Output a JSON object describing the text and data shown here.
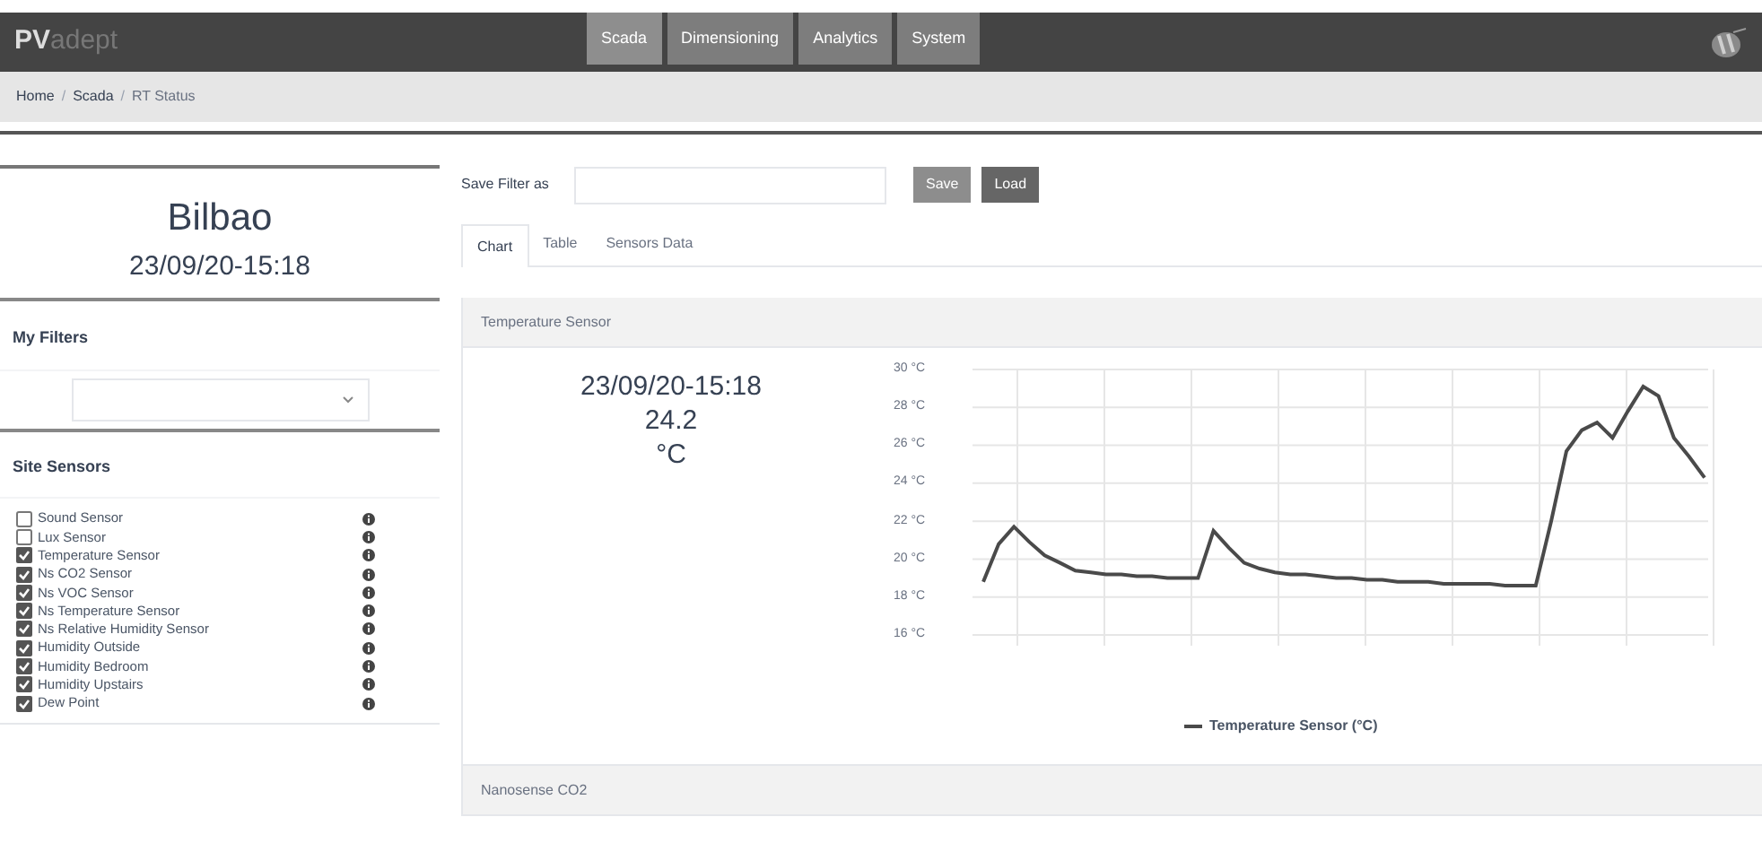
{
  "logo": {
    "bold": "PV",
    "rest": "adept"
  },
  "nav": [
    {
      "label": "Scada",
      "selected": true
    },
    {
      "label": "Dimensioning",
      "selected": false
    },
    {
      "label": "Analytics",
      "selected": false
    },
    {
      "label": "System",
      "selected": false
    }
  ],
  "breadcrumb": [
    "Home",
    "Scada",
    "RT Status"
  ],
  "breadcrumb_separator": "/",
  "site": {
    "name": "Bilbao",
    "timestamp": "23/09/20-15:18"
  },
  "my_filters": {
    "title": "My Filters"
  },
  "site_sensors": {
    "title": "Site Sensors",
    "items": [
      {
        "label": "Sound Sensor",
        "checked": false
      },
      {
        "label": "Lux Sensor",
        "checked": false
      },
      {
        "label": "Temperature Sensor",
        "checked": true
      },
      {
        "label": "Ns CO2 Sensor",
        "checked": true
      },
      {
        "label": "Ns VOC Sensor",
        "checked": true
      },
      {
        "label": "Ns Temperature Sensor",
        "checked": true
      },
      {
        "label": "Ns Relative Humidity Sensor",
        "checked": true
      },
      {
        "label": "Humidity Outside",
        "checked": true
      },
      {
        "label": "Humidity Bedroom",
        "checked": true
      },
      {
        "label": "Humidity Upstairs",
        "checked": true
      },
      {
        "label": "Dew Point",
        "checked": true
      }
    ]
  },
  "save_filter": {
    "label": "Save Filter as",
    "buttons": [
      {
        "label": "Save",
        "kind": "light"
      },
      {
        "label": "Load",
        "kind": "dark"
      }
    ]
  },
  "tabs": [
    {
      "label": "Chart",
      "selected": true
    },
    {
      "label": "Table",
      "selected": false
    },
    {
      "label": "Sensors Data",
      "selected": false
    }
  ],
  "panels": [
    {
      "title": "Temperature Sensor",
      "timestamp": "23/09/20-15:18",
      "value": "24.2",
      "unit": "°C",
      "chart_data": {
        "type": "line",
        "grid": true,
        "ylim": [
          16,
          30
        ],
        "yticks": [
          {
            "value": 30,
            "label": "30 °C"
          },
          {
            "value": 28,
            "label": "28 °C"
          },
          {
            "value": 26,
            "label": "26 °C"
          },
          {
            "value": 24,
            "label": "24 °C"
          },
          {
            "value": 22,
            "label": "22 °C"
          },
          {
            "value": 20,
            "label": "20 °C"
          },
          {
            "value": 18,
            "label": "18 °C"
          },
          {
            "value": 16,
            "label": "16 °C"
          }
        ],
        "series": [
          {
            "name": "Temperature Sensor (°C)",
            "color": "#4a4a4a",
            "values": [
              18.8,
              20.8,
              21.7,
              20.9,
              20.2,
              19.8,
              19.4,
              19.3,
              19.2,
              19.2,
              19.1,
              19.1,
              19.0,
              19.0,
              19.0,
              21.5,
              20.6,
              19.8,
              19.5,
              19.3,
              19.2,
              19.2,
              19.1,
              19.0,
              19.0,
              18.9,
              18.9,
              18.8,
              18.8,
              18.8,
              18.7,
              18.7,
              18.7,
              18.7,
              18.6,
              18.6,
              18.6,
              22.0,
              25.7,
              26.8,
              27.2,
              26.4,
              27.8,
              29.1,
              28.6,
              26.4,
              25.4,
              24.3
            ]
          }
        ]
      }
    },
    {
      "title": "Nanosense CO2"
    }
  ]
}
